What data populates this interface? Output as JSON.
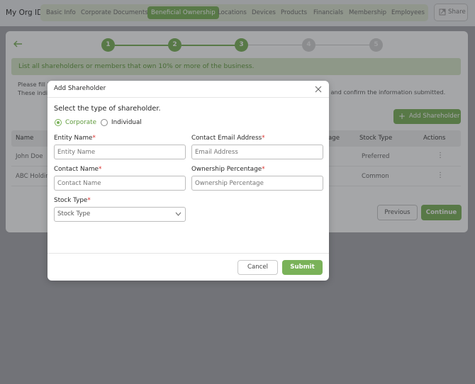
{
  "header": {
    "brand": "My Org ID",
    "tabs": [
      {
        "label": "Basic Info"
      },
      {
        "label": "Corporate Documents"
      },
      {
        "label": "Beneficial Ownership",
        "active": true
      },
      {
        "label": "Locations"
      },
      {
        "label": "Devices"
      },
      {
        "label": "Products"
      },
      {
        "label": "Financials"
      },
      {
        "label": "Membership"
      },
      {
        "label": "Employees"
      }
    ],
    "share_label": "Share"
  },
  "stepper": {
    "steps": [
      "1",
      "2",
      "3",
      "4",
      "5"
    ],
    "current": 3
  },
  "page": {
    "banner": "List all shareholders or members that own 10% or more of the business.",
    "intro_line1": "Please fill i",
    "intro_line2": "These indiv",
    "intro_end": "v and confirm the information submitted.",
    "add_button": "Add Shareholder",
    "table": {
      "columns": [
        "Name",
        "age",
        "Stock Type",
        "Actions"
      ],
      "rows": [
        {
          "name": "John Doe",
          "stock_type": "Preferred"
        },
        {
          "name": "ABC Holding",
          "stock_type": "Common"
        }
      ]
    },
    "previous_label": "Previous",
    "continue_label": "Continue"
  },
  "modal": {
    "title": "Add Shareholder",
    "prompt": "Select the type of shareholder.",
    "options": [
      {
        "label": "Corporate",
        "selected": true
      },
      {
        "label": "Individual",
        "selected": false
      }
    ],
    "fields": {
      "entity_name": {
        "label": "Entity Name",
        "placeholder": "Entity Name",
        "value": ""
      },
      "contact_email": {
        "label": "Contact Email Address",
        "placeholder": "Email Address",
        "value": ""
      },
      "contact_name": {
        "label": "Contact Name",
        "placeholder": "Contact Name",
        "value": ""
      },
      "ownership": {
        "label": "Ownership Percentage",
        "placeholder": "Ownership Percentage",
        "value": ""
      },
      "stock_type": {
        "label": "Stock Type",
        "selected": "Stock Type"
      }
    },
    "required_mark": "*",
    "cancel_label": "Cancel",
    "submit_label": "Submit"
  },
  "colors": {
    "accent": "#7ab259",
    "banner_bg": "#d8e7c9",
    "required": "#d9302c",
    "overlay": "rgba(40,42,48,0.42)"
  },
  "icons": [
    "arrow-left-icon",
    "share-icon",
    "plus-icon",
    "close-icon",
    "chevron-down-icon",
    "more-vertical-icon"
  ]
}
